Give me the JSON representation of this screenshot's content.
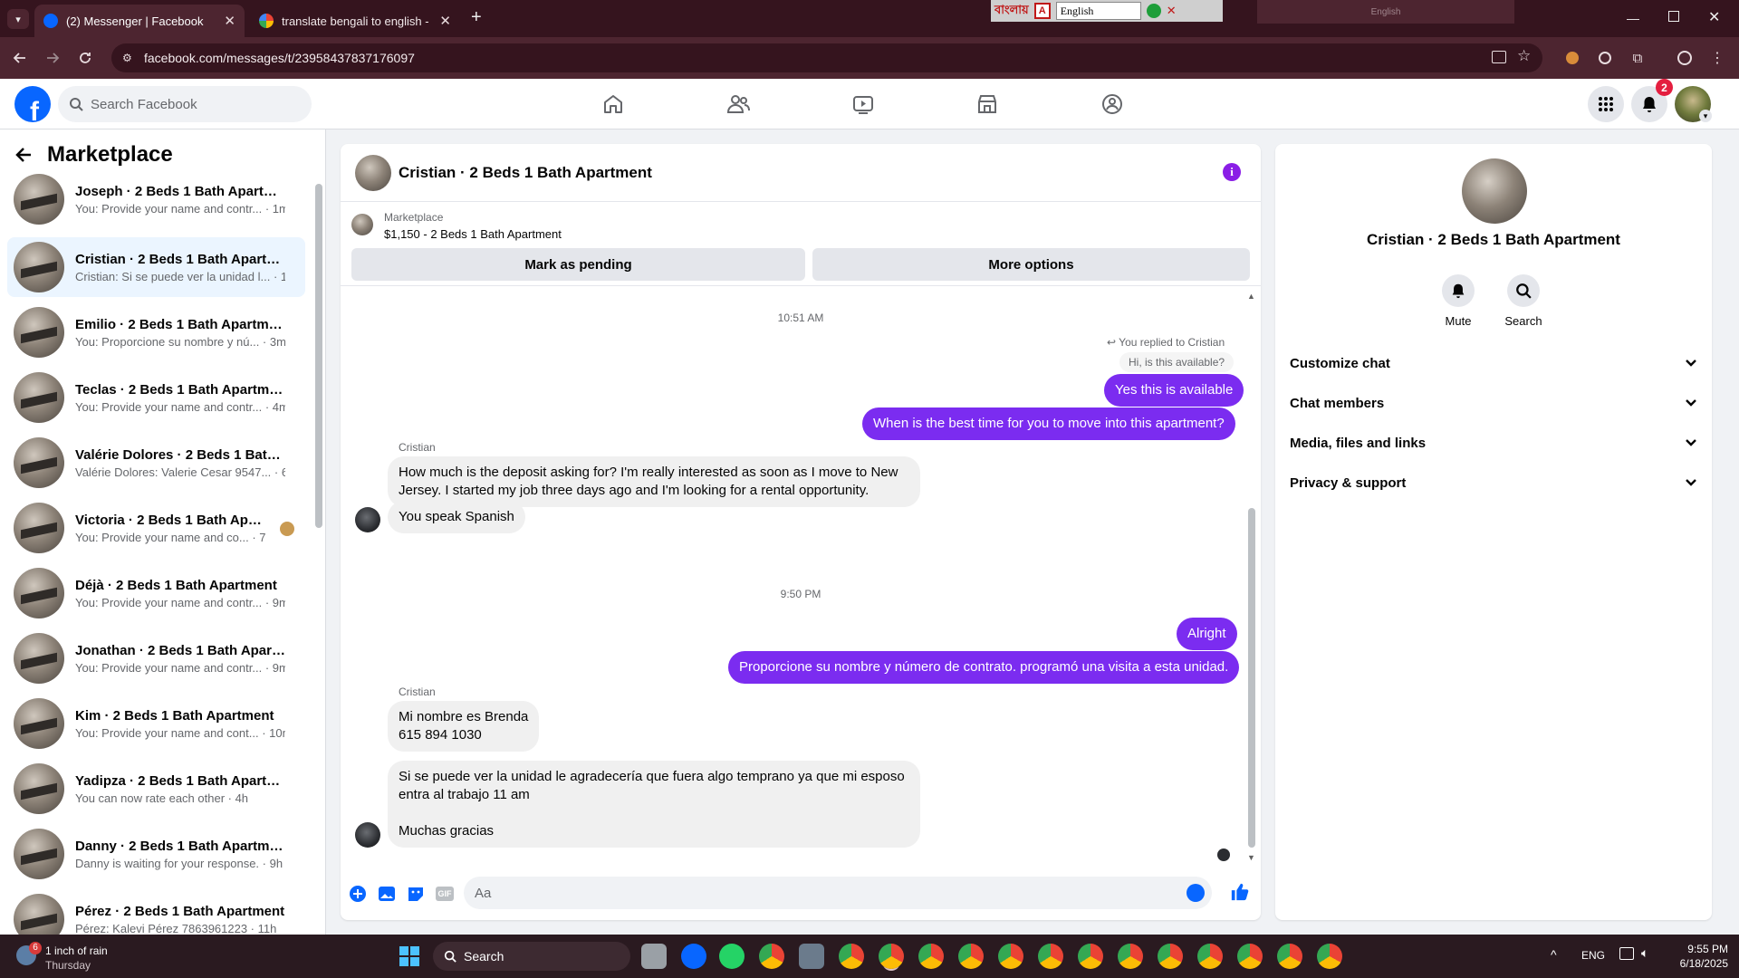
{
  "browser": {
    "tabs": [
      {
        "title": "(2) Messenger | Facebook",
        "active": true
      },
      {
        "title": "translate bengali to english - Go",
        "active": false
      }
    ],
    "url": "facebook.com/messages/t/23958437837176097",
    "translator_bar": {
      "brand": "বাংলায়",
      "language": "English",
      "small_label": "English"
    }
  },
  "fb": {
    "search_placeholder": "Search Facebook",
    "notif_count": "2"
  },
  "left": {
    "title": "Marketplace",
    "conversations": [
      {
        "name": "Joseph · 2 Beds 1 Bath Apartment",
        "preview": "You: Provide your name and contr... · 1m",
        "selected": false
      },
      {
        "name": "Cristian · 2 Beds 1 Bath Apartment",
        "preview": "Cristian: Si se puede ver la unidad l... · 1m",
        "selected": true
      },
      {
        "name": "Emilio · 2 Beds 1 Bath Apartment",
        "preview": "You: Proporcione su nombre y nú... · 3m",
        "selected": false
      },
      {
        "name": "Teclas · 2 Beds 1 Bath Apartment",
        "preview": "You: Provide your name and contr... · 4m",
        "selected": false
      },
      {
        "name": "Valérie Dolores · 2 Beds 1 Bath A...",
        "preview": "Valérie Dolores: Valerie Cesar 9547... · 6m",
        "selected": false
      },
      {
        "name": "Victoria · 2 Beds 1 Bath Apart...",
        "preview": "You: Provide your name and co... · 7m",
        "selected": false
      },
      {
        "name": "Déjà · 2 Beds 1 Bath Apartment",
        "preview": "You: Provide your name and contr... · 9m",
        "selected": false
      },
      {
        "name": "Jonathan · 2 Beds 1 Bath Apartm...",
        "preview": "You: Provide your name and contr... · 9m",
        "selected": false
      },
      {
        "name": "Kim · 2 Beds 1 Bath Apartment",
        "preview": "You: Provide your name and cont... · 10m",
        "selected": false
      },
      {
        "name": "Yadipza · 2 Beds 1 Bath Apartment",
        "preview": "You can now rate each other · 4h",
        "selected": false
      },
      {
        "name": "Danny · 2 Beds 1 Bath Apartment",
        "preview": "Danny is waiting for your response. · 9h",
        "selected": false
      },
      {
        "name": "Pérez · 2 Beds 1 Bath Apartment",
        "preview": "Pérez: Kalevi Pérez 7863961223 · 11h",
        "selected": false
      }
    ]
  },
  "chat": {
    "title": "Cristian · 2 Beds 1 Bath Apartment",
    "listing": {
      "source": "Marketplace",
      "price_title": "$1,150 - 2 Beds 1 Bath Apartment",
      "btn_pending": "Mark as pending",
      "btn_more": "More options"
    },
    "timestamps": [
      "10:51 AM",
      "9:50 PM"
    ],
    "reply_label": "You replied to Cristian",
    "quoted": "Hi, is this available?",
    "messages": {
      "m1": "Yes this is available",
      "m2": "When is the best time for you to move into this apartment?",
      "sender": "Cristian",
      "m3": "How much is the deposit asking for? I'm really interested as soon as I move to New Jersey. I started my job three days ago and I'm looking for a rental opportunity.",
      "m4": "You speak Spanish",
      "m5": "Alright",
      "m6": "Proporcione su nombre y número de contrato. programó una visita a esta unidad.",
      "m7_line1": "Mi nombre es Brenda",
      "m7_line2": "615 894 1030",
      "m8_line1": "Si se puede ver la unidad le agradecería que fuera algo temprano ya que mi esposo",
      "m8_line2": "entra al trabajo 11 am",
      "m8_line3": "Muchas gracias"
    },
    "composer_placeholder": "Aa"
  },
  "right": {
    "name": "Cristian · 2 Beds 1 Bath Apartment",
    "actions": [
      "Mute",
      "Search"
    ],
    "sections": [
      "Customize chat",
      "Chat members",
      "Media, files and links",
      "Privacy & support"
    ]
  },
  "taskbar": {
    "weather_badge": "6",
    "weather_line1": "1 inch of rain",
    "weather_line2": "Thursday",
    "search": "Search",
    "lang": "ENG",
    "time": "9:55 PM",
    "date": "6/18/2025"
  },
  "colors": {
    "accent": "#7b2cf0",
    "fb_blue": "#0866ff",
    "chrome_bg": "#35141e"
  }
}
